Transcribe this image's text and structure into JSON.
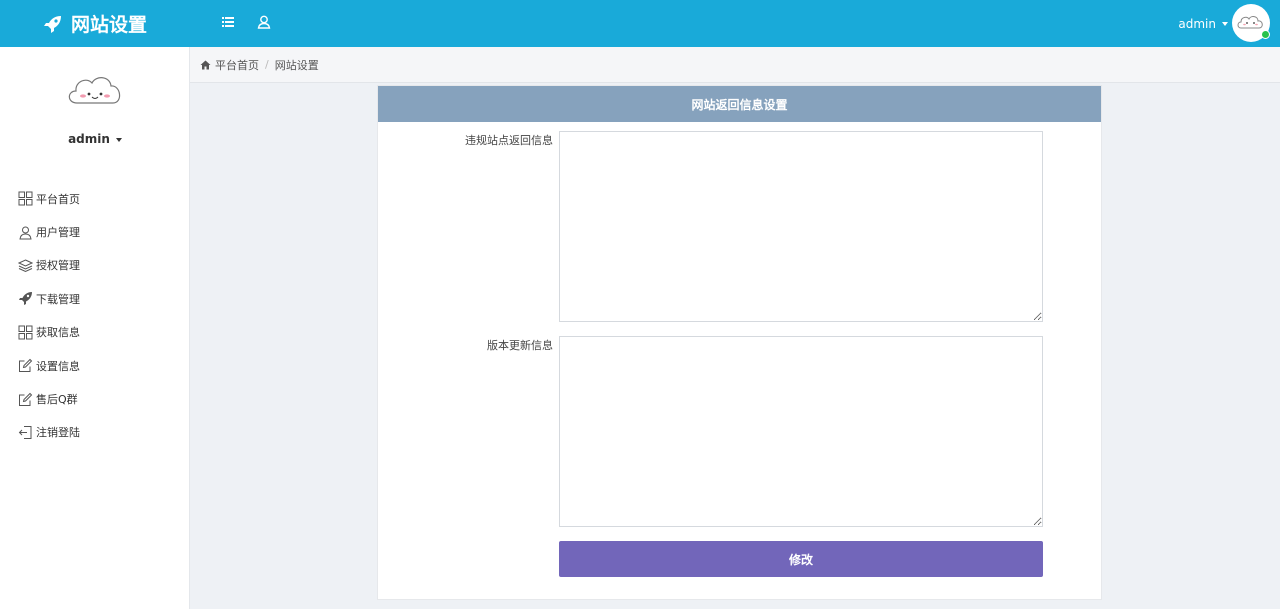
{
  "header": {
    "brand_title": "网站设置",
    "user_name": "admin",
    "accent_color": "#19aad9",
    "icons": [
      "menu-icon",
      "user-icon"
    ]
  },
  "sidebar": {
    "user_name": "admin",
    "items": [
      {
        "label": "平台首页",
        "icon": "grid-icon"
      },
      {
        "label": "用户管理",
        "icon": "user-icon"
      },
      {
        "label": "授权管理",
        "icon": "layers-icon"
      },
      {
        "label": "下载管理",
        "icon": "rocket-icon"
      },
      {
        "label": "获取信息",
        "icon": "grid-icon"
      },
      {
        "label": "设置信息",
        "icon": "edit-icon"
      },
      {
        "label": "售后Q群",
        "icon": "edit-icon"
      },
      {
        "label": "注销登陆",
        "icon": "logout-icon"
      }
    ]
  },
  "breadcrumb": {
    "home": "平台首页",
    "current": "网站设置"
  },
  "panel": {
    "title": "网站返回信息设置",
    "header_color": "#86a2bd",
    "fields": [
      {
        "label": "违规站点返回信息",
        "value": ""
      },
      {
        "label": "版本更新信息",
        "value": ""
      }
    ],
    "submit_label": "修改",
    "submit_color": "#7266ba"
  }
}
